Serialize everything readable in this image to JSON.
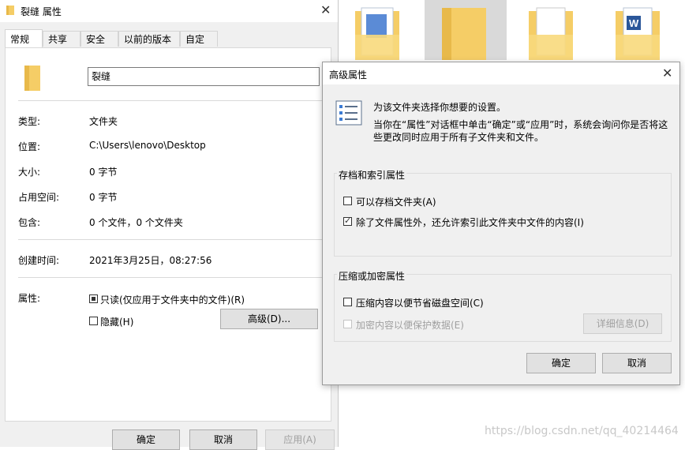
{
  "props_window": {
    "title": "裂缝 属性",
    "tabs": [
      "常规",
      "共享",
      "安全",
      "以前的版本",
      "自定义"
    ],
    "folder_name": "裂缝",
    "rows": {
      "type_label": "类型:",
      "type_value": "文件夹",
      "location_label": "位置:",
      "location_value": "C:\\Users\\lenovo\\Desktop",
      "size_label": "大小:",
      "size_value": "0 字节",
      "disk_label": "占用空间:",
      "disk_value": "0 字节",
      "contains_label": "包含:",
      "contains_value": "0 个文件，0 个文件夹",
      "created_label": "创建时间:",
      "created_value": "2021年3月25日，08:27:56",
      "attr_label": "属性:"
    },
    "readonly_label": "只读(仅应用于文件夹中的文件)(R)",
    "hidden_label": "隐藏(H)",
    "advanced_button": "高级(D)...",
    "ok_button": "确定",
    "cancel_button": "取消",
    "apply_button": "应用(A)"
  },
  "advanced_dialog": {
    "title": "高级属性",
    "intro": "为该文件夹选择你想要的设置。",
    "desc_line1": "当你在“属性”对话框中单击“确定”或“应用”时，系统会询问你是否将这",
    "desc_line2": "些更改同时应用于所有子文件夹和文件。",
    "archive_group": "存档和索引属性",
    "archive_cb": "可以存档文件夹(A)",
    "index_cb": "除了文件属性外，还允许索引此文件夹中文件的内容(I)",
    "compress_group": "压缩或加密属性",
    "compress_cb": "压缩内容以便节省磁盘空间(C)",
    "encrypt_cb": "加密内容以便保护数据(E)",
    "details_button": "详细信息(D)",
    "ok_button": "确定",
    "cancel_button": "取消"
  },
  "watermark": "https://blog.csdn.net/qq_40214464",
  "colors": {
    "folder": "#f5cd66",
    "folder_dark": "#e8b94a",
    "selected": "#d9d9d9"
  }
}
